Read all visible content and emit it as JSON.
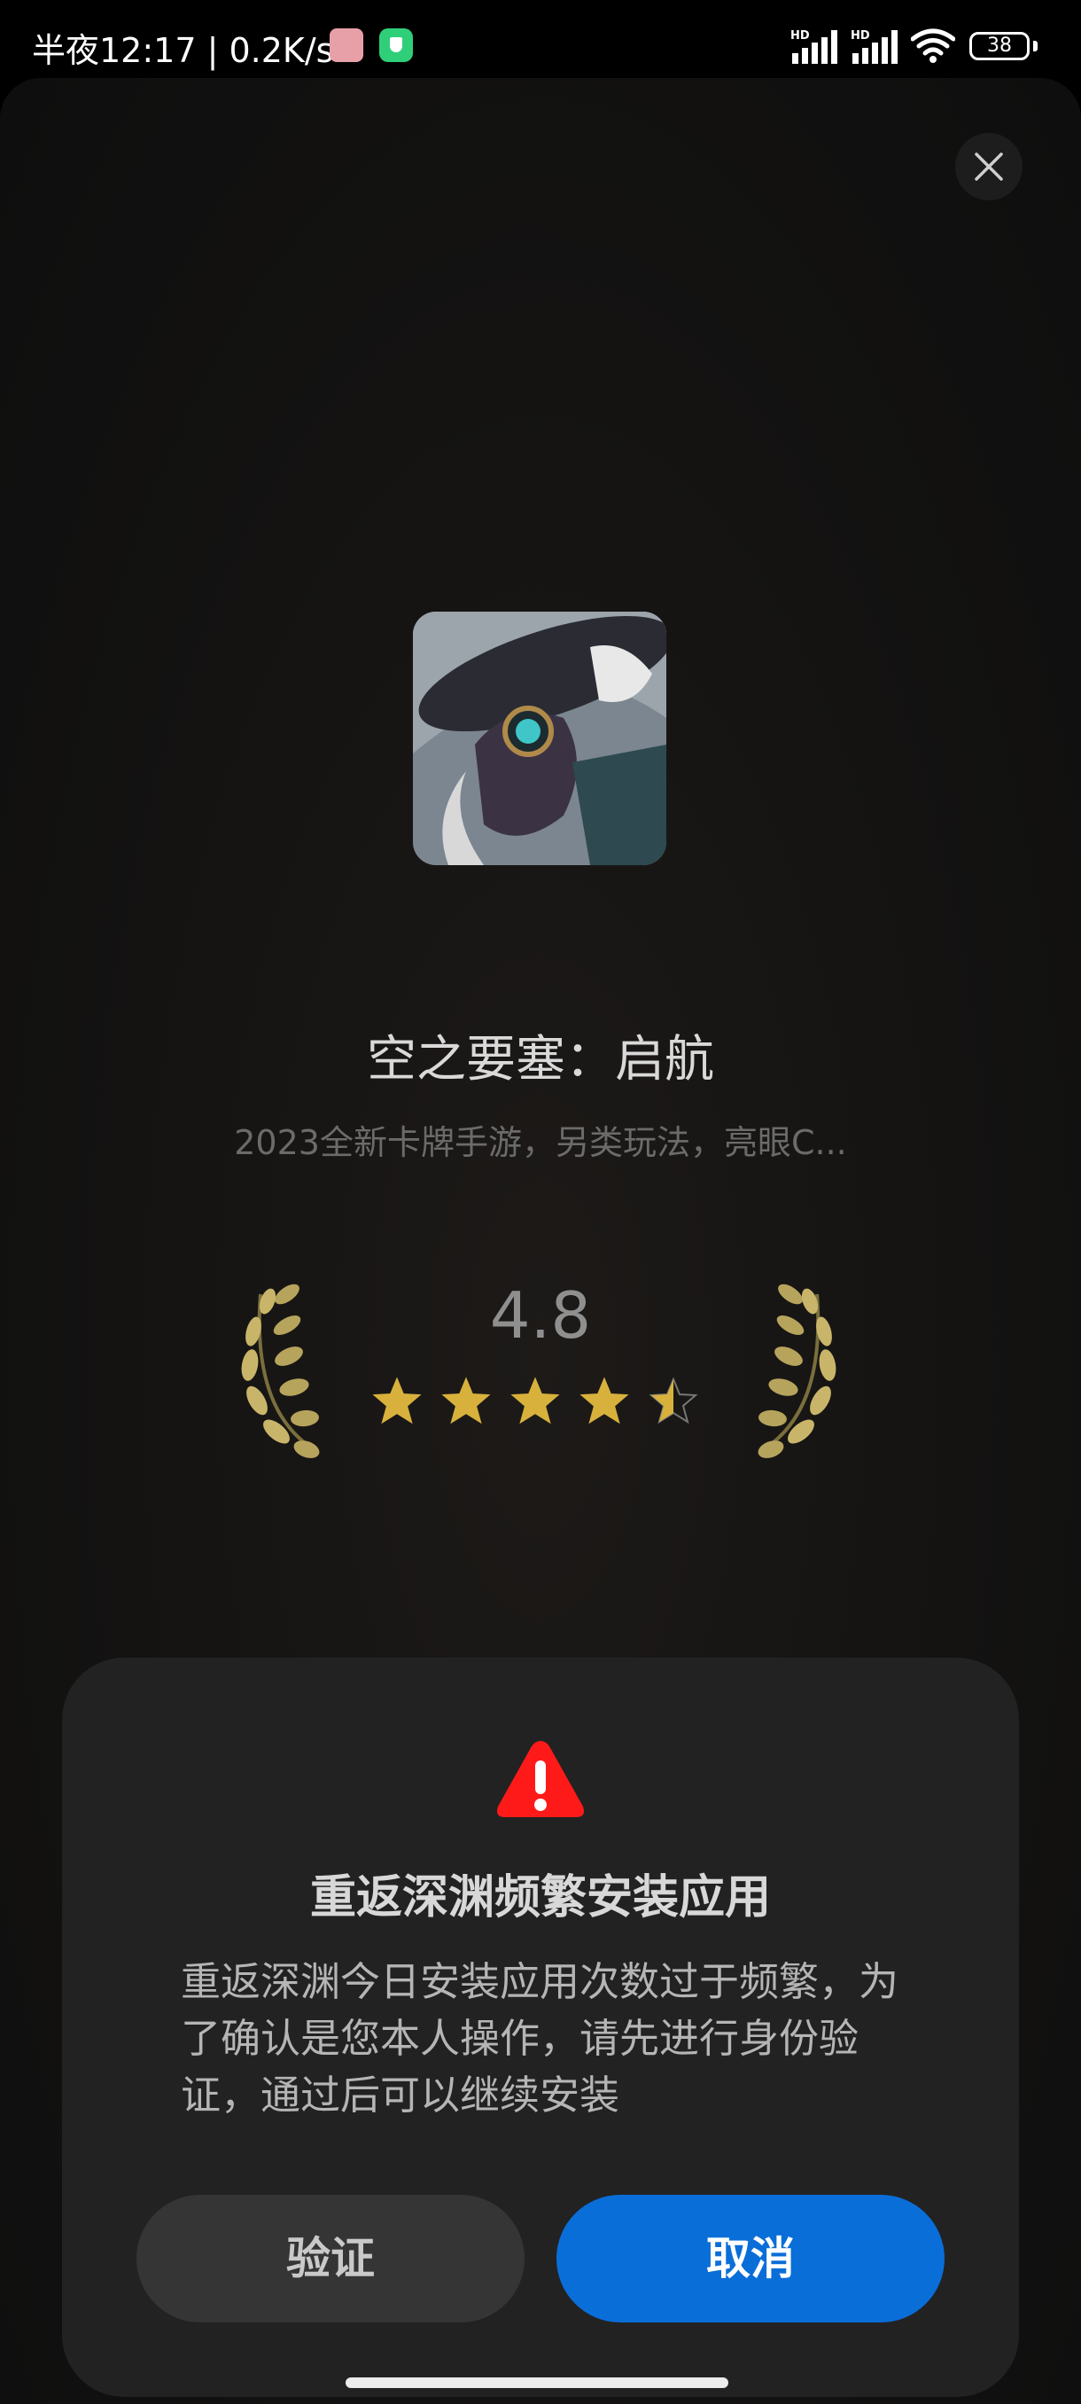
{
  "status_bar": {
    "time_text": "半夜12:17 | 0.2K/s",
    "signal_1": "HD",
    "signal_2": "HD",
    "battery": "38"
  },
  "app": {
    "title": "空之要塞：启航",
    "description": "2023全新卡牌手游，另类玩法，亮眼C...",
    "rating": "4.8",
    "stars_filled": 4.5,
    "stars_total": 5
  },
  "dialog": {
    "title": "重返深渊频繁安装应用",
    "message": "重返深渊今日安装应用次数过于频繁，为了确认是您本人操作，请先进行身份验证，通过后可以继续安装",
    "verify_label": "验证",
    "cancel_label": "取消"
  },
  "colors": {
    "accent": "#0a6ed9",
    "warning": "#ff1a1a",
    "star": "#d8b13c"
  }
}
